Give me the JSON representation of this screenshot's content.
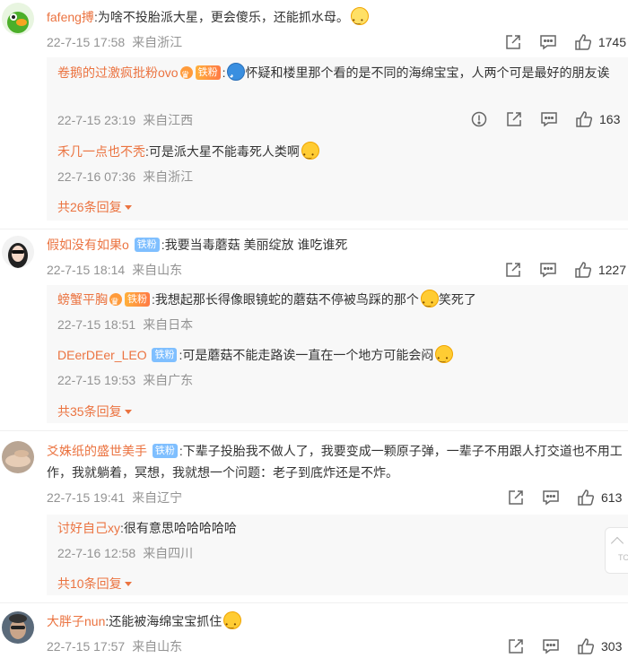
{
  "comments": [
    {
      "user": "fafeng搏",
      "text": ":为啥不投胎派大星，更会傻乐，还能抓水母。",
      "date": "22-7-15 17:58",
      "location": "来自浙江",
      "likes": "1745",
      "replies": [
        {
          "user": "卷鹅的过激疯批粉ovo",
          "badge": "铁粉",
          "text": "怀疑和楼里那个看的是不同的海绵宝宝，人两个可是最好的朋友诶",
          "date": "22-7-15 23:19",
          "location": "来自江西",
          "likes": "163"
        },
        {
          "user": "禾几一点也不秃",
          "text": ":可是派大星不能毒死人类啊",
          "date": "22-7-16 07:36",
          "location": "来自浙江"
        }
      ],
      "more": "共26条回复"
    },
    {
      "user": "假如没有如果o",
      "badge": "铁粉",
      "text": ":我要当毒蘑菇 美丽绽放 谁吃谁死",
      "date": "22-7-15 18:14",
      "location": "来自山东",
      "likes": "1227",
      "replies": [
        {
          "user": "螃蟹平胸",
          "badge": "铁粉",
          "text": ":我想起那长得像眼镜蛇的蘑菇不停被鸟踩的那个",
          "text2": "笑死了",
          "date": "22-7-15 18:51",
          "location": "来自日本"
        },
        {
          "user": "DEerDEer_LEO",
          "badge": "铁粉",
          "text": ":可是蘑菇不能走路诶一直在一个地方可能会闷",
          "date": "22-7-15 19:53",
          "location": "来自广东"
        }
      ],
      "more": "共35条回复"
    },
    {
      "user": "爻姝纸的盛世美手",
      "badge": "铁粉",
      "text": ":下辈子投胎我不做人了，我要变成一颗原子弹，一辈子不用跟人打交道也不用工作，我就躺着，冥想，我就想一个问题：老子到底炸还是不炸。",
      "date": "22-7-15 19:41",
      "location": "来自辽宁",
      "likes": "613",
      "replies": [
        {
          "user": "讨好自己xy",
          "text": ":很有意思哈哈哈哈哈",
          "date": "22-7-16 12:58",
          "location": "来自四川"
        }
      ],
      "more": "共10条回复"
    },
    {
      "user": "大胖子nun",
      "text": ":还能被海绵宝宝抓住",
      "date": "22-7-15 17:57",
      "location": "来自山东",
      "likes": "303"
    }
  ],
  "top_button": "TOP",
  "colors": {
    "username": "#eb7340",
    "meta": "#939393",
    "badge": "#7fbfff",
    "reply_bg": "#f8f8f8"
  },
  "icons": [
    "share-icon",
    "comment-icon",
    "like-icon",
    "report-icon"
  ]
}
